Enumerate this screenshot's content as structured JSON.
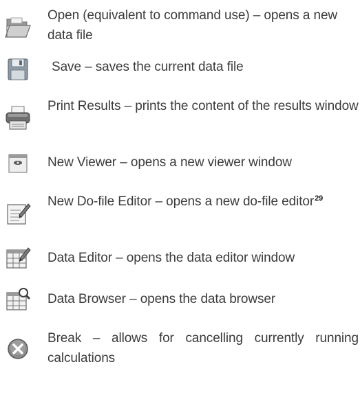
{
  "toolbar_items": [
    {
      "icon": "open-folder-icon",
      "text": "Open (equivalent to command use) – opens a new data file"
    },
    {
      "icon": "save-floppy-icon",
      "text": "Save – saves the current data file"
    },
    {
      "icon": "printer-icon",
      "text": "Print Results – prints the content of the results window"
    },
    {
      "icon": "viewer-icon",
      "text": "New Viewer – opens a new viewer window"
    },
    {
      "icon": "do-file-editor-icon",
      "text": "New Do-file Editor – opens a new do-file editor",
      "footnote": "29"
    },
    {
      "icon": "data-editor-icon",
      "text": "Data Editor – opens the data editor window"
    },
    {
      "icon": "data-browser-icon",
      "text": "Data Browser – opens the data browser"
    },
    {
      "icon": "break-icon",
      "text": "Break – allows for cancelling currently running calculations"
    }
  ]
}
